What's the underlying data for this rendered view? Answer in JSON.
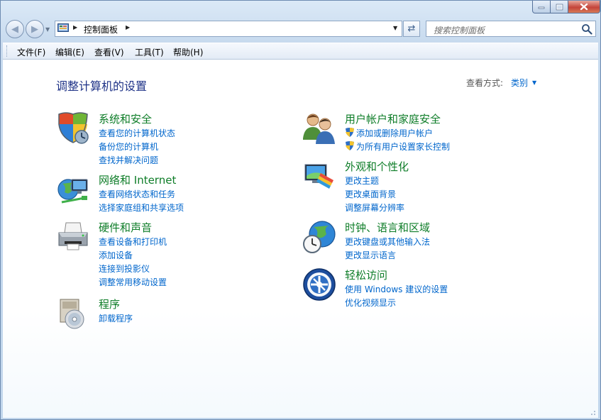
{
  "address": {
    "breadcrumb": "控制面板"
  },
  "search": {
    "placeholder": "搜索控制面板"
  },
  "menu": {
    "file": "文件(F)",
    "edit": "编辑(E)",
    "view": "查看(V)",
    "tools": "工具(T)",
    "help": "帮助(H)"
  },
  "page": {
    "title": "调整计算机的设置",
    "view_by_label": "查看方式:",
    "view_by_value": "类别"
  },
  "categories": {
    "system_security": {
      "title": "系统和安全",
      "links": [
        "查看您的计算机状态",
        "备份您的计算机",
        "查找并解决问题"
      ]
    },
    "network": {
      "title": "网络和 Internet",
      "links": [
        "查看网络状态和任务",
        "选择家庭组和共享选项"
      ]
    },
    "hardware": {
      "title": "硬件和声音",
      "links": [
        "查看设备和打印机",
        "添加设备",
        "连接到投影仪",
        "调整常用移动设置"
      ]
    },
    "programs": {
      "title": "程序",
      "links": [
        "卸载程序"
      ]
    },
    "user_accounts": {
      "title": "用户帐户和家庭安全",
      "links": [
        "添加或删除用户帐户",
        "为所有用户设置家长控制"
      ]
    },
    "appearance": {
      "title": "外观和个性化",
      "links": [
        "更改主题",
        "更改桌面背景",
        "调整屏幕分辨率"
      ]
    },
    "clock_region": {
      "title": "时钟、语言和区域",
      "links": [
        "更改键盘或其他输入法",
        "更改显示语言"
      ]
    },
    "ease_access": {
      "title": "轻松访问",
      "links": [
        "使用 Windows 建议的设置",
        "优化视频显示"
      ]
    }
  },
  "icons": {
    "back": "back-arrow-icon",
    "forward": "forward-arrow-icon",
    "refresh": "refresh-icon",
    "search": "search-icon",
    "control_panel": "control-panel-icon"
  },
  "colors": {
    "category_title": "#0e7d28",
    "link": "#0066cc",
    "page_title": "#1e3287"
  }
}
